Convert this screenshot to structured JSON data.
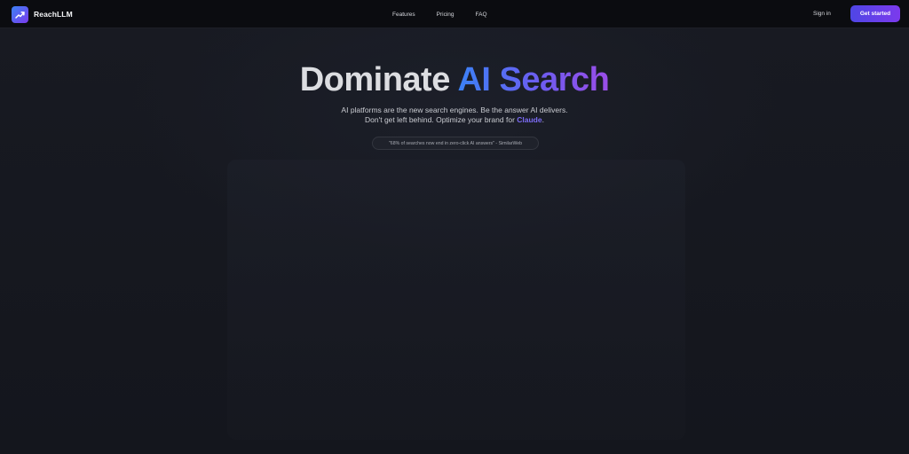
{
  "brand": {
    "name": "ReachLLM",
    "logo_icon": "trend-arrow-icon",
    "logo_colors": [
      "#3b82f6",
      "#7c3aed"
    ]
  },
  "nav": {
    "links": [
      "Features",
      "Pricing",
      "FAQ"
    ],
    "signin_label": "Sign in",
    "cta_label": "Get started"
  },
  "hero": {
    "title_part1": "Dominate ",
    "title_part2": "AI Search",
    "subtitle_line1": "AI platforms are the new search engines. Be the answer AI delivers.",
    "subtitle_line2_prefix": "Don't get left behind. Optimize your brand for ",
    "subtitle_highlight": "Claude",
    "subtitle_line2_suffix": ".",
    "quote": "\"68% of searches now end in zero-click AI answers\" - SimilarWeb"
  },
  "colors": {
    "accent_start": "#4f46e5",
    "accent_end": "#7c3aed",
    "gradient_blue": "#3b82f6",
    "background": "#15171e"
  }
}
